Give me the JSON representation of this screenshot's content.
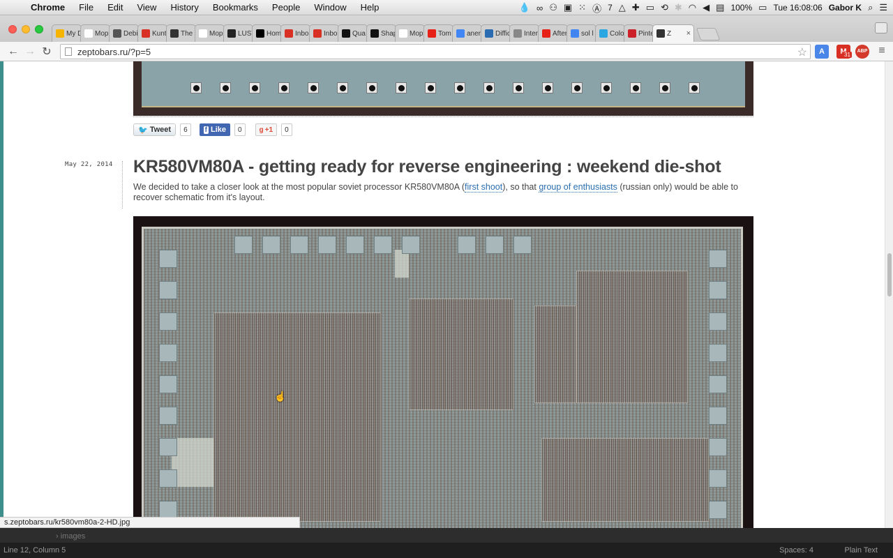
{
  "menubar": {
    "app": "Chrome",
    "items": [
      "File",
      "Edit",
      "View",
      "History",
      "Bookmarks",
      "People",
      "Window",
      "Help"
    ],
    "right": {
      "badge_count": "7",
      "battery": "100%",
      "clock": "Tue 16:08:06",
      "user": "Gabor K"
    }
  },
  "tabs": [
    {
      "label": "My D",
      "icon": "drive-icon",
      "color": "#f4b400"
    },
    {
      "label": "Mop",
      "icon": "doc-icon",
      "color": "#ffffff"
    },
    {
      "label": "Debi",
      "icon": "table-icon",
      "color": "#555555"
    },
    {
      "label": "Kunt",
      "icon": "gmail-icon",
      "color": "#d93025"
    },
    {
      "label": "The",
      "icon": "site-icon",
      "color": "#333333"
    },
    {
      "label": "Mop",
      "icon": "doc-icon",
      "color": "#ffffff"
    },
    {
      "label": "LUST",
      "icon": "site-icon",
      "color": "#222222"
    },
    {
      "label": "Hom",
      "icon": "medium-icon",
      "color": "#000000"
    },
    {
      "label": "Inbo",
      "icon": "gmail-icon",
      "color": "#d93025"
    },
    {
      "label": "Inbo",
      "icon": "gmail-icon",
      "color": "#d93025"
    },
    {
      "label": "Qua",
      "icon": "app-icon",
      "color": "#111111"
    },
    {
      "label": "Shap",
      "icon": "app-icon",
      "color": "#111111"
    },
    {
      "label": "Mop",
      "icon": "doc-icon",
      "color": "#ffffff"
    },
    {
      "label": "Tom",
      "icon": "youtube-icon",
      "color": "#e62117"
    },
    {
      "label": "aner",
      "icon": "google-icon",
      "color": "#4285f4"
    },
    {
      "label": "Diffic",
      "icon": "hb-icon",
      "color": "#2b6cb0"
    },
    {
      "label": "Inter",
      "icon": "user-icon",
      "color": "#888888"
    },
    {
      "label": "After",
      "icon": "youtube-icon",
      "color": "#e62117"
    },
    {
      "label": "sol l",
      "icon": "google-icon",
      "color": "#4285f4"
    },
    {
      "label": "Colo",
      "icon": "app-icon",
      "color": "#2aa7e0"
    },
    {
      "label": "Pinte",
      "icon": "pinterest-icon",
      "color": "#cb2027"
    },
    {
      "label": "Z",
      "icon": "zepto-icon",
      "color": "#333333",
      "active": true
    }
  ],
  "toolbar": {
    "url": "zeptobars.ru/?p=5",
    "extensions": [
      {
        "name": "translate-icon",
        "color": "#4a86e8",
        "text": "A"
      },
      {
        "name": "gmail-ext-icon",
        "color": "#d93025",
        "text": "M"
      },
      {
        "name": "adblock-icon",
        "color": "#d33a2c",
        "text": "ABP"
      }
    ],
    "gmail_badge": "31"
  },
  "share": {
    "tweet_label": "Tweet",
    "tweet_count": "6",
    "like_label": "Like",
    "like_count": "0",
    "gplus_label": "+1",
    "gplus_count": "0"
  },
  "post": {
    "date": "May 22, 2014",
    "title": "KR580VM80A - getting ready for reverse engineering : weekend die-shot",
    "text_before": "We decided to take a closer look at the most popular soviet processor KR580VM80A (",
    "link1": "first shoot",
    "text_mid": "), so that ",
    "link2": "group of enthusiasts",
    "text_after": " (russian only) would be able to recover schematic from it's layout."
  },
  "status_url": "s.zeptobars.ru/kr580vm80a-2-HD.jpg",
  "editor": {
    "tree_item": "images",
    "position": "Line 12, Column 5",
    "spaces": "Spaces: 4",
    "syntax": "Plain Text"
  }
}
